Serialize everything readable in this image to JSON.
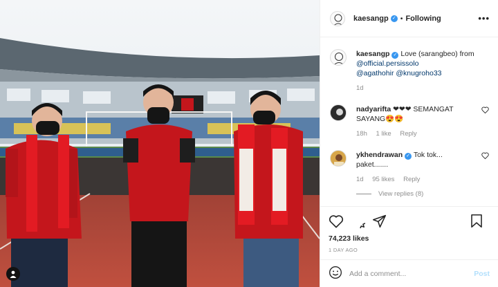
{
  "post_owner": {
    "username": "kaesangp",
    "verified": true,
    "follow_state": "Following"
  },
  "header": {
    "separator": "•",
    "more_icon": "more-horizontal-icon"
  },
  "caption": {
    "username": "kaesangp",
    "text": "Love (sarangbeo) from",
    "mentions": [
      "@official.persissolo",
      "@agathohir",
      "@knugroho33"
    ],
    "time": "1d"
  },
  "comments": [
    {
      "username": "nadyarifta",
      "verified": false,
      "text": "❤❤❤ SEMANGAT SAYANG😍😍",
      "time": "18h",
      "likes": "1 like",
      "reply_label": "Reply"
    },
    {
      "username": "ykhendrawan",
      "verified": true,
      "text": "Tok tok... paket.......",
      "time": "1d",
      "likes": "95 likes",
      "reply_label": "Reply",
      "view_replies": "View replies (8)"
    }
  ],
  "actions": {
    "like_icon": "heart-icon",
    "comment_icon": "comment-icon",
    "share_icon": "share-icon",
    "save_icon": "bookmark-icon"
  },
  "stats": {
    "likes": "74,223 likes",
    "time_ago": "1 DAY AGO"
  },
  "comment_input": {
    "placeholder": "Add a comment...",
    "post_label": "Post",
    "emoji_icon": "smiley-icon"
  },
  "photo": {
    "description_icon": "user-tag-icon",
    "colors": {
      "jersey": "#c4161c",
      "scarf": "#e31b23",
      "track": "#b5473a",
      "sky": "#f2f4f6"
    }
  }
}
